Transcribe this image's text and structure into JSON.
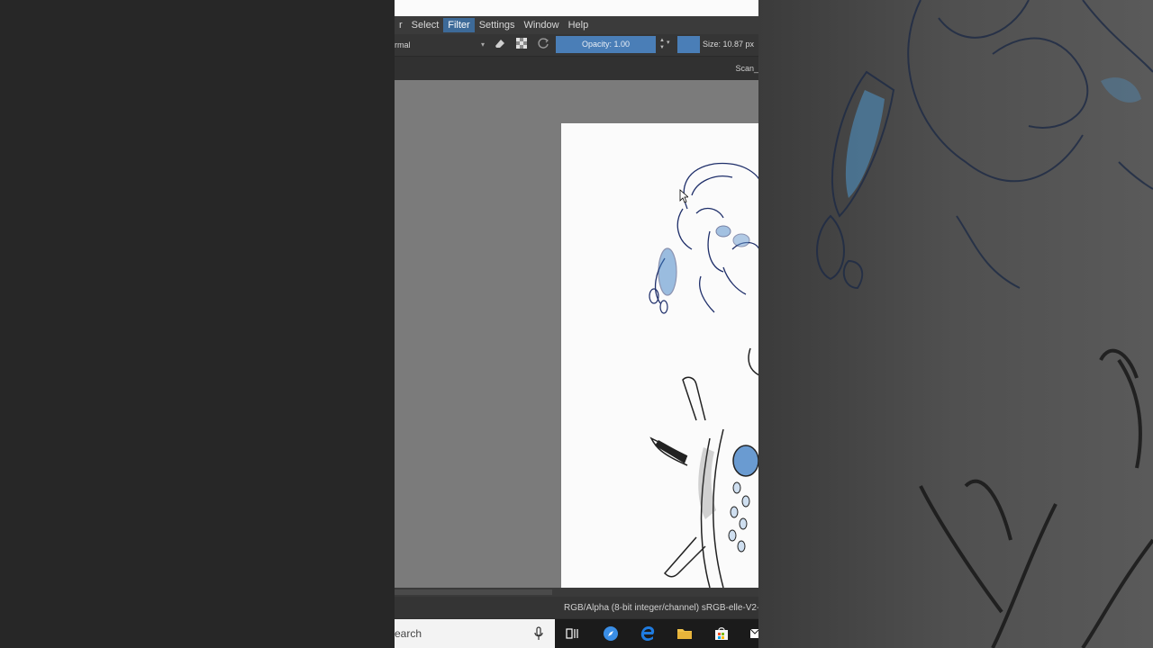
{
  "menu": [
    {
      "label": "r"
    },
    {
      "label": "Select"
    },
    {
      "label": "Filter",
      "active": true
    },
    {
      "label": "Settings"
    },
    {
      "label": "Window"
    },
    {
      "label": "Help"
    }
  ],
  "toolbar": {
    "blend_mode": "rmal",
    "opacity_label": "Opacity:  1.00",
    "size_label": "Size:  10.87 px"
  },
  "tab": {
    "label": "Scan_"
  },
  "status": {
    "text": "RGB/Alpha (8-bit integer/channel)  sRGB-elle-V2-"
  },
  "taskbar": {
    "search_text": "earch"
  },
  "colors": {
    "accent": "#4a7eb7",
    "menu_active": "#3d6a98",
    "canvas_bg": "#7b7b7b"
  }
}
